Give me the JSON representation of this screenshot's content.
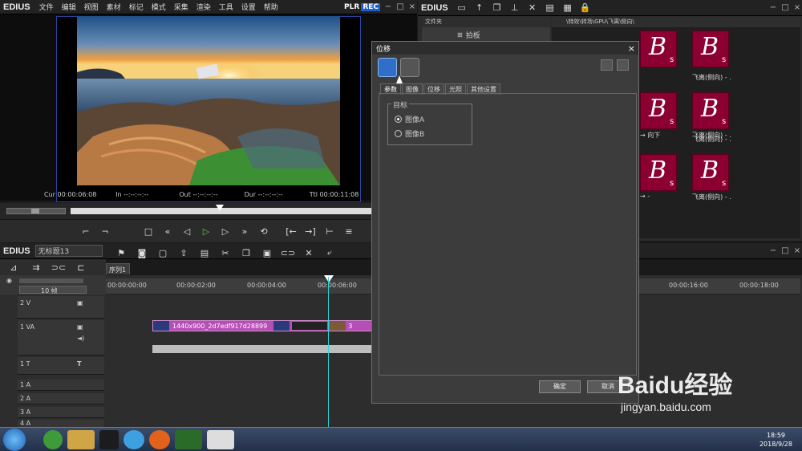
{
  "menubar": {
    "logo": "EDIUS",
    "items": [
      "文件",
      "编辑",
      "视图",
      "素材",
      "标记",
      "模式",
      "采集",
      "渲染",
      "工具",
      "设置",
      "帮助"
    ],
    "plr": "PLR",
    "rec": "REC"
  },
  "player": {
    "cur": "Cur 00:00:06:08",
    "in": "In --:--:--:--",
    "out": "Out --:--:--:--",
    "dur": "Dur --:--:--:--",
    "ttl": "Ttl 00:00:11:08",
    "progress": 0.43
  },
  "bin": {
    "logo": "EDIUS",
    "folder_header": "文件夹",
    "folder_item": "拍板",
    "path": "\\特效\\转场\\GPU\\飞离\\侧向\\",
    "thumbs": [
      {
        "label": "",
        "row": 0
      },
      {
        "label": "",
        "row": 0
      },
      {
        "label": "",
        "row": 0
      },
      {
        "label": "→ 向下",
        "row": 1
      },
      {
        "label": "飞离(侧向) - .",
        "row": 1
      },
      {
        "label": "飞离(侧向) - .",
        "row": 1
      },
      {
        "label": "→ -",
        "row": 2
      },
      {
        "label": "飞离(侧向) - .",
        "row": 2
      },
      {
        "label": "飞离(侧向) - .",
        "row": 2
      }
    ]
  },
  "timeline": {
    "logo": "EDIUS",
    "project": "无标题13",
    "sequence_tab": "序列1",
    "zoom": "10 帧",
    "ruler": [
      "00:00:00:00",
      "00:00:02:00",
      "00:00:04:00",
      "00:00:06:00",
      "00:00:16:00",
      "00:00:18:00"
    ],
    "tracks": [
      "2 V",
      "1 VA",
      "1 T",
      "1 A",
      "2 A",
      "3 A",
      "4 A"
    ],
    "clip_name": "1440x900_2d7edf917d28899",
    "clip_extra": "3"
  },
  "dialog": {
    "title": "位移",
    "tabs": [
      "参数",
      "图像",
      "位移",
      "光照",
      "其他设置"
    ],
    "group_label": "目标",
    "options": [
      {
        "label": "图像A",
        "selected": true
      },
      {
        "label": "图像B",
        "selected": false
      }
    ],
    "ok": "确定",
    "cancel": "取消"
  },
  "taskbar": {
    "time": "18:59",
    "date": "2018/9/28"
  },
  "watermark": {
    "brand": "Baidu经验",
    "url": "jingyan.baidu.com"
  },
  "colors": {
    "accent": "#2cd4d9",
    "clip": "#b64fb5",
    "thumb": "#8b0030",
    "rec": "#1c5cd0"
  }
}
